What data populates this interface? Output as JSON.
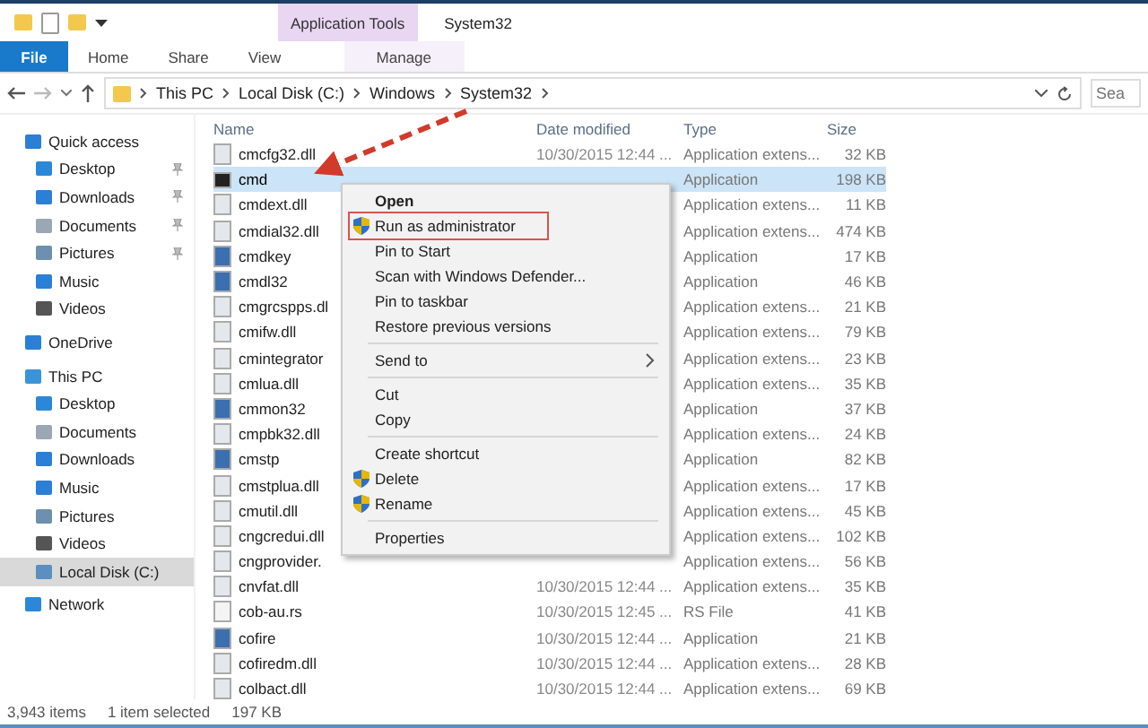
{
  "window": {
    "title": "System32"
  },
  "ribbon": {
    "context_group": "Application Tools",
    "tabs": [
      {
        "label": "File",
        "kind": "file",
        "selected": true
      },
      {
        "label": "Home",
        "kind": "plain",
        "selected": false
      },
      {
        "label": "Share",
        "kind": "plain",
        "selected": false
      },
      {
        "label": "View",
        "kind": "plain",
        "selected": false
      },
      {
        "label": "Manage",
        "kind": "context",
        "selected": false
      }
    ]
  },
  "address": {
    "crumbs": [
      "This PC",
      "Local Disk (C:)",
      "Windows",
      "System32"
    ],
    "search_placeholder": "Sea"
  },
  "sidebar": {
    "items": [
      {
        "label": "Quick access",
        "kind": "star",
        "selected": false,
        "children": [
          {
            "label": "Desktop",
            "kind": "desktop",
            "pinned": true,
            "selected": false
          },
          {
            "label": "Downloads",
            "kind": "download",
            "pinned": true,
            "selected": false
          },
          {
            "label": "Documents",
            "kind": "doc",
            "pinned": true,
            "selected": false
          },
          {
            "label": "Pictures",
            "kind": "picture",
            "pinned": true,
            "selected": false
          },
          {
            "label": "Music",
            "kind": "music",
            "pinned": false,
            "selected": false
          },
          {
            "label": "Videos",
            "kind": "video",
            "pinned": false,
            "selected": false
          }
        ]
      },
      {
        "label": "OneDrive",
        "kind": "cloud",
        "selected": false
      },
      {
        "label": "This PC",
        "kind": "pc",
        "selected": false,
        "children": [
          {
            "label": "Desktop",
            "kind": "desktop",
            "pinned": false,
            "selected": false
          },
          {
            "label": "Documents",
            "kind": "doc",
            "pinned": false,
            "selected": false
          },
          {
            "label": "Downloads",
            "kind": "download",
            "pinned": false,
            "selected": false
          },
          {
            "label": "Music",
            "kind": "music",
            "pinned": false,
            "selected": false
          },
          {
            "label": "Pictures",
            "kind": "picture",
            "pinned": false,
            "selected": false
          },
          {
            "label": "Videos",
            "kind": "video",
            "pinned": false,
            "selected": false
          },
          {
            "label": "Local Disk (C:)",
            "kind": "disk",
            "pinned": false,
            "selected": true
          }
        ]
      },
      {
        "label": "Network",
        "kind": "network",
        "selected": false
      }
    ]
  },
  "table": {
    "columns": [
      "Name",
      "Date modified",
      "Type",
      "Size"
    ],
    "rows": [
      {
        "name": "cmcfg32.dll",
        "kind": "dll",
        "date": "10/30/2015 12:44 ...",
        "type": "Application extens...",
        "size": "32 KB",
        "selected": false
      },
      {
        "name": "cmd",
        "kind": "console",
        "type": "Application",
        "size": "198 KB",
        "selected": true
      },
      {
        "name": "cmdext.dll",
        "kind": "dll",
        "type": "Application extens...",
        "size": "11 KB",
        "selected": false
      },
      {
        "name": "cmdial32.dll",
        "kind": "dll",
        "type": "Application extens...",
        "size": "474 KB",
        "selected": false
      },
      {
        "name": "cmdkey",
        "kind": "app",
        "type": "Application",
        "size": "17 KB",
        "selected": false
      },
      {
        "name": "cmdl32",
        "kind": "app",
        "type": "Application",
        "size": "46 KB",
        "selected": false
      },
      {
        "name": "cmgrcspps.dl",
        "kind": "dll",
        "type": "Application extens...",
        "size": "21 KB",
        "selected": false
      },
      {
        "name": "cmifw.dll",
        "kind": "dll",
        "type": "Application extens...",
        "size": "79 KB",
        "selected": false
      },
      {
        "name": "cmintegrator",
        "kind": "dll",
        "type": "Application extens...",
        "size": "23 KB",
        "selected": false
      },
      {
        "name": "cmlua.dll",
        "kind": "dll",
        "type": "Application extens...",
        "size": "35 KB",
        "selected": false
      },
      {
        "name": "cmmon32",
        "kind": "app",
        "type": "Application",
        "size": "37 KB",
        "selected": false
      },
      {
        "name": "cmpbk32.dll",
        "kind": "dll",
        "type": "Application extens...",
        "size": "24 KB",
        "selected": false
      },
      {
        "name": "cmstp",
        "kind": "app",
        "type": "Application",
        "size": "82 KB",
        "selected": false
      },
      {
        "name": "cmstplua.dll",
        "kind": "dll",
        "type": "Application extens...",
        "size": "17 KB",
        "selected": false
      },
      {
        "name": "cmutil.dll",
        "kind": "dll",
        "type": "Application extens...",
        "size": "45 KB",
        "selected": false
      },
      {
        "name": "cngcredui.dll",
        "kind": "dll",
        "type": "Application extens...",
        "size": "102 KB",
        "selected": false
      },
      {
        "name": "cngprovider.",
        "kind": "dll",
        "type": "Application extens...",
        "size": "56 KB",
        "selected": false
      },
      {
        "name": "cnvfat.dll",
        "kind": "dll",
        "date": "10/30/2015 12:44 ...",
        "type": "Application extens...",
        "size": "35 KB",
        "selected": false
      },
      {
        "name": "cob-au.rs",
        "kind": "file",
        "date": "10/30/2015 12:45 ...",
        "type": "RS File",
        "size": "41 KB",
        "selected": false
      },
      {
        "name": "cofire",
        "kind": "app",
        "date": "10/30/2015 12:44 ...",
        "type": "Application",
        "size": "21 KB",
        "selected": false
      },
      {
        "name": "cofiredm.dll",
        "kind": "dll",
        "date": "10/30/2015 12:44 ...",
        "type": "Application extens...",
        "size": "28 KB",
        "selected": false
      },
      {
        "name": "colbact.dll",
        "kind": "dll",
        "date": "10/30/2015 12:44 ...",
        "type": "Application extens...",
        "size": "69 KB",
        "selected": false
      }
    ]
  },
  "context_menu": {
    "items": [
      {
        "kind": "item",
        "label": "Open",
        "bold": true,
        "shield": false,
        "highlighted": false
      },
      {
        "kind": "item",
        "label": "Run as administrator",
        "bold": false,
        "shield": true,
        "highlighted": true
      },
      {
        "kind": "item",
        "label": "Pin to Start",
        "bold": false,
        "shield": false,
        "highlighted": false
      },
      {
        "kind": "item",
        "label": "Scan with Windows Defender...",
        "bold": false,
        "shield": false,
        "highlighted": false
      },
      {
        "kind": "item",
        "label": "Pin to taskbar",
        "bold": false,
        "shield": false,
        "highlighted": false
      },
      {
        "kind": "item",
        "label": "Restore previous versions",
        "bold": false,
        "shield": false,
        "highlighted": false
      },
      {
        "kind": "separator"
      },
      {
        "kind": "submenu",
        "label": "Send to",
        "bold": false,
        "shield": false,
        "highlighted": false
      },
      {
        "kind": "separator"
      },
      {
        "kind": "item",
        "label": "Cut",
        "bold": false,
        "shield": false,
        "highlighted": false
      },
      {
        "kind": "item",
        "label": "Copy",
        "bold": false,
        "shield": false,
        "highlighted": false
      },
      {
        "kind": "separator"
      },
      {
        "kind": "item",
        "label": "Create shortcut",
        "bold": false,
        "shield": false,
        "highlighted": false
      },
      {
        "kind": "item",
        "label": "Delete",
        "bold": false,
        "shield": true,
        "highlighted": false
      },
      {
        "kind": "item",
        "label": "Rename",
        "bold": false,
        "shield": true,
        "highlighted": false
      },
      {
        "kind": "separator"
      },
      {
        "kind": "item",
        "label": "Properties",
        "bold": false,
        "shield": false,
        "highlighted": false
      }
    ]
  },
  "status_bar": {
    "count": "3,943 items",
    "selection": "1 item selected",
    "size": "197 KB"
  }
}
